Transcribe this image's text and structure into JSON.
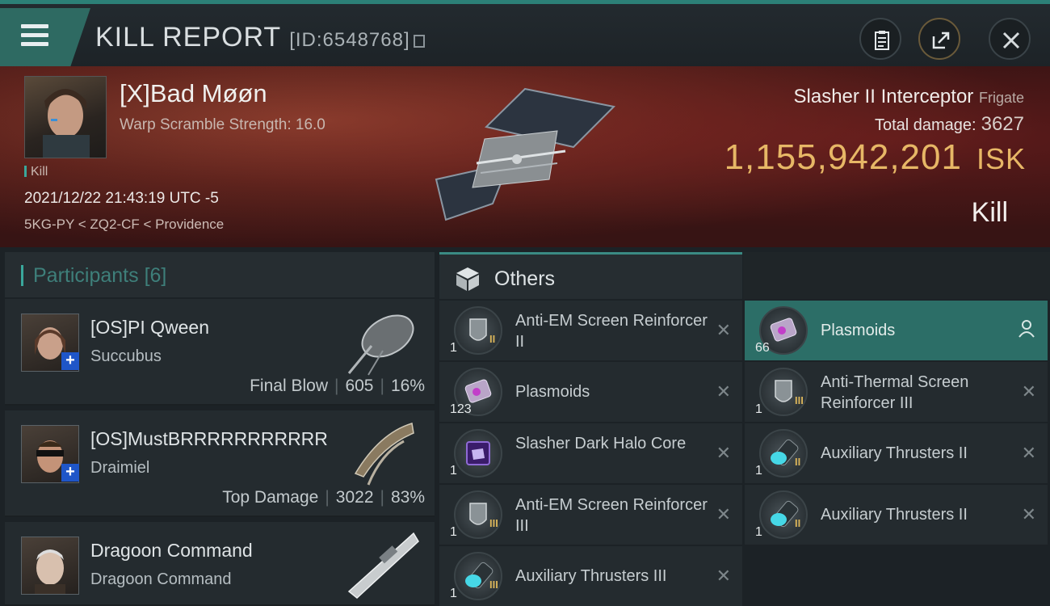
{
  "header": {
    "title": "KILL REPORT",
    "id_label": "[ID:6548768]"
  },
  "victim": {
    "name": "[X]Bad Møøn",
    "scramble": "Warp Scramble Strength: 16.0",
    "tag": "Kill",
    "datetime": "2021/12/22 21:43:19 UTC -5",
    "location": "5KG-PY < ZQ2-CF < Providence",
    "ship": "Slasher II Interceptor",
    "ship_class": "Frigate",
    "damage_label": "Total damage:",
    "damage_value": "3627",
    "isk_value": "1,155,942,201",
    "isk_unit": "ISK",
    "result": "Kill"
  },
  "participants": {
    "label": "Participants",
    "count": "[6]",
    "rows": [
      {
        "name": "[OS]PI Qween",
        "ship": "Succubus",
        "stat_label": "Final Blow",
        "damage": "605",
        "percent": "16%",
        "plus": "+"
      },
      {
        "name": "[OS]MustBRRRRRRRRRRR",
        "ship": "Draimiel",
        "stat_label": "Top Damage",
        "damage": "3022",
        "percent": "83%",
        "plus": "+"
      },
      {
        "name": "Dragoon Command",
        "ship": "Dragoon Command"
      }
    ]
  },
  "others": {
    "label": "Others",
    "left_items": [
      {
        "name": "Anti-EM Screen Reinforcer II",
        "qty": "1",
        "tier": "II"
      },
      {
        "name": "Plasmoids",
        "qty": "123",
        "tier": ""
      },
      {
        "name": "Slasher Dark Halo Core",
        "qty": "1",
        "tier": ""
      },
      {
        "name": "Anti-EM Screen Reinforcer III",
        "qty": "1",
        "tier": "III"
      },
      {
        "name": "Auxiliary Thrusters III",
        "qty": "1",
        "tier": "III"
      }
    ],
    "right_items": [
      {
        "name": "Plasmoids",
        "qty": "66",
        "tier": ""
      },
      {
        "name": "Anti-Thermal Screen Reinforcer III",
        "qty": "1",
        "tier": "III"
      },
      {
        "name": "Auxiliary Thrusters II",
        "qty": "1",
        "tier": "II"
      },
      {
        "name": "Auxiliary Thrusters II",
        "qty": "1",
        "tier": "II"
      }
    ],
    "remove_glyph": "✕"
  },
  "icons": [
    "menu-icon",
    "clipboard-icon",
    "share-icon",
    "close-icon",
    "copy-icon",
    "cube-icon",
    "user-icon"
  ],
  "colors": {
    "accent": "#3aa79b",
    "isk": "#e7b766",
    "selected_row": "#2c6e67"
  }
}
